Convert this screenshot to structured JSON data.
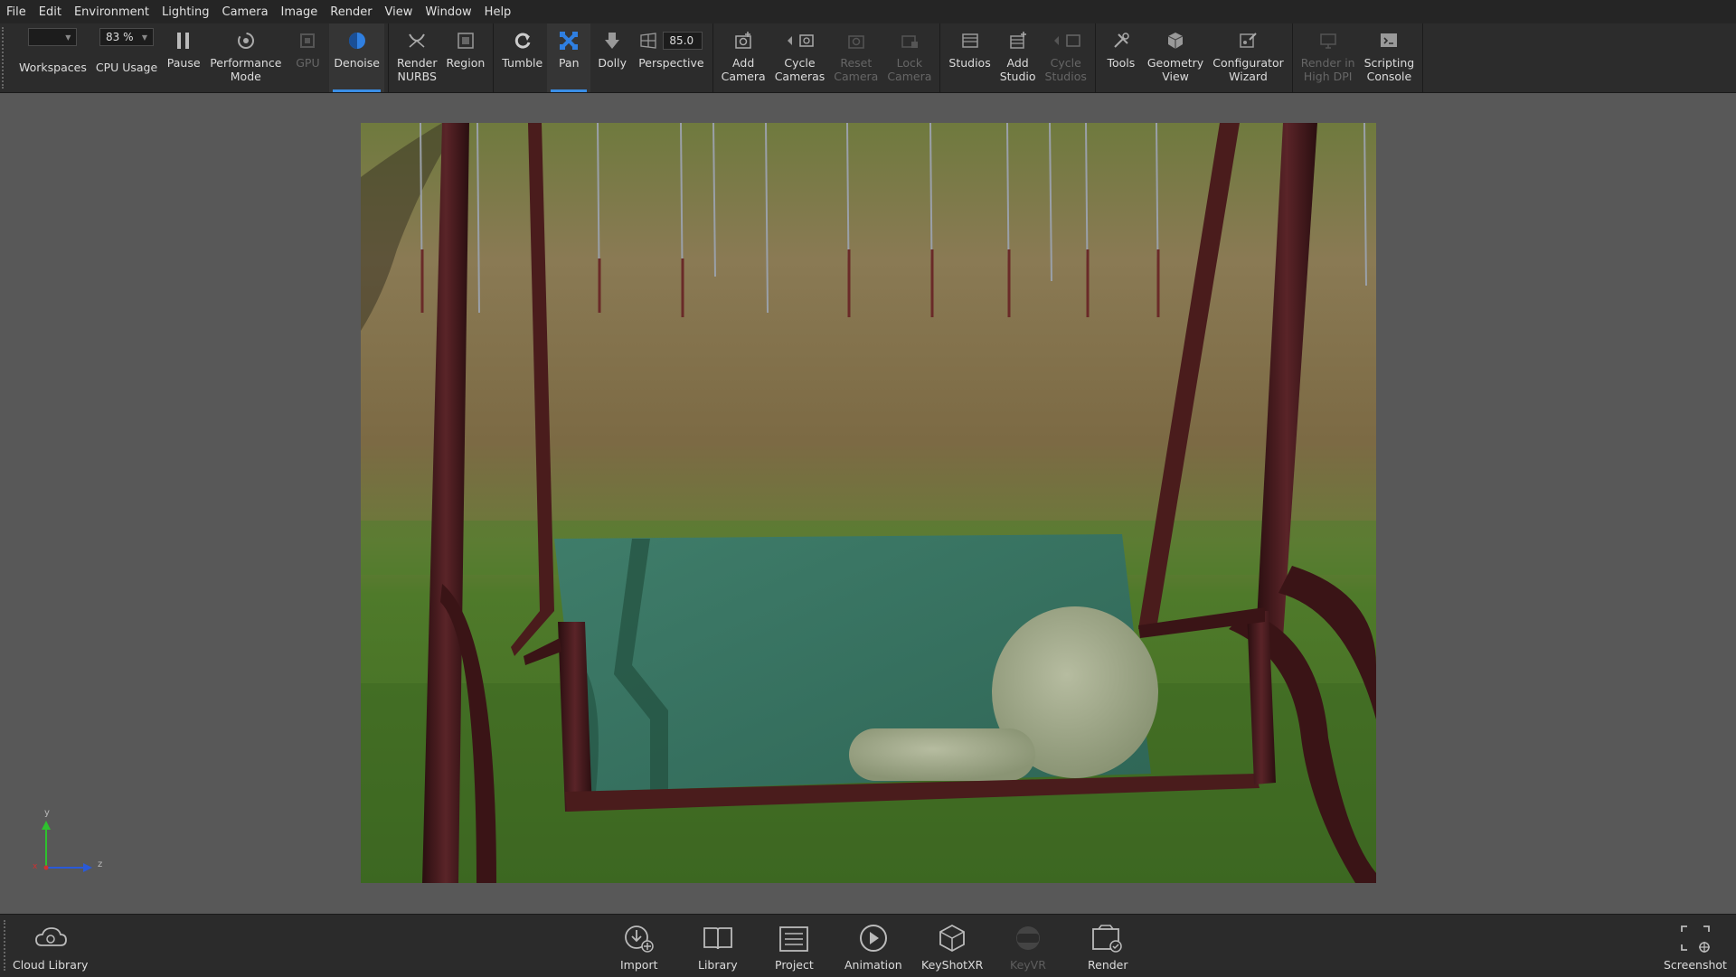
{
  "menu": [
    "File",
    "Edit",
    "Environment",
    "Lighting",
    "Camera",
    "Image",
    "Render",
    "View",
    "Window",
    "Help"
  ],
  "toolbar": {
    "workspaces_label": "Workspaces",
    "cpu_value": "83 %",
    "cpu_label": "CPU Usage",
    "pause_label": "Pause",
    "performance_label": "Performance\nMode",
    "gpu_label": "GPU",
    "denoise_label": "Denoise",
    "render_nurbs_label": "Render\nNURBS",
    "region_label": "Region",
    "tumble_label": "Tumble",
    "pan_label": "Pan",
    "dolly_label": "Dolly",
    "perspective_value": "85.0",
    "perspective_label": "Perspective",
    "add_camera_label": "Add\nCamera",
    "cycle_cameras_label": "Cycle\nCameras",
    "reset_camera_label": "Reset\nCamera",
    "lock_camera_label": "Lock\nCamera",
    "studios_label": "Studios",
    "add_studio_label": "Add\nStudio",
    "cycle_studios_label": "Cycle\nStudios",
    "tools_label": "Tools",
    "geometry_view_label": "Geometry\nView",
    "configurator_label": "Configurator\nWizard",
    "render_hidpi_label": "Render in\nHigh DPI",
    "scripting_label": "Scripting\nConsole"
  },
  "axis": {
    "y": "y",
    "z": "z",
    "x": "x"
  },
  "bottom": {
    "cloud_library": "Cloud Library",
    "import": "Import",
    "library": "Library",
    "project": "Project",
    "animation": "Animation",
    "keyshotxr": "KeyShotXR",
    "keyvr": "KeyVR",
    "render": "Render",
    "screenshot": "Screenshot"
  },
  "colors": {
    "accent": "#3a8ee6",
    "cushion": "#3d7a68",
    "frame": "#4a1c1c"
  }
}
